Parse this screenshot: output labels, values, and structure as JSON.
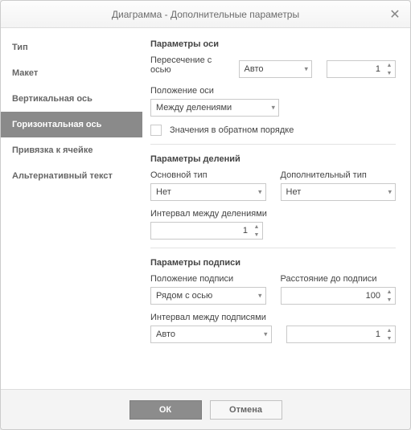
{
  "dialog": {
    "title": "Диаграмма - Дополнительные параметры",
    "close_label": "✕"
  },
  "sidebar": {
    "items": [
      {
        "label": "Тип"
      },
      {
        "label": "Макет"
      },
      {
        "label": "Вертикальная ось"
      },
      {
        "label": "Горизонтальная ось"
      },
      {
        "label": "Привязка к ячейке"
      },
      {
        "label": "Альтернативный текст"
      }
    ],
    "active_index": 3
  },
  "axis_params": {
    "title": "Параметры оси",
    "cross_label": "Пересечение с осью",
    "cross_value": "Авто",
    "cross_number": "1",
    "position_label": "Положение оси",
    "position_value": "Между делениями",
    "reverse_label": "Значения в обратном порядке",
    "reverse_checked": false
  },
  "ticks": {
    "title": "Параметры делений",
    "major_label": "Основной тип",
    "major_value": "Нет",
    "minor_label": "Дополнительный тип",
    "minor_value": "Нет",
    "interval_label": "Интервал между делениями",
    "interval_value": "1"
  },
  "labels": {
    "title": "Параметры подписи",
    "position_label": "Положение подписи",
    "position_value": "Рядом с осью",
    "distance_label": "Расстояние до подписи",
    "distance_value": "100",
    "interval_label": "Интервал между подписями",
    "interval_mode": "Авто",
    "interval_value": "1"
  },
  "footer": {
    "ok": "ОК",
    "cancel": "Отмена"
  },
  "icons": {
    "caret": "▾",
    "up": "▲",
    "down": "▼"
  }
}
